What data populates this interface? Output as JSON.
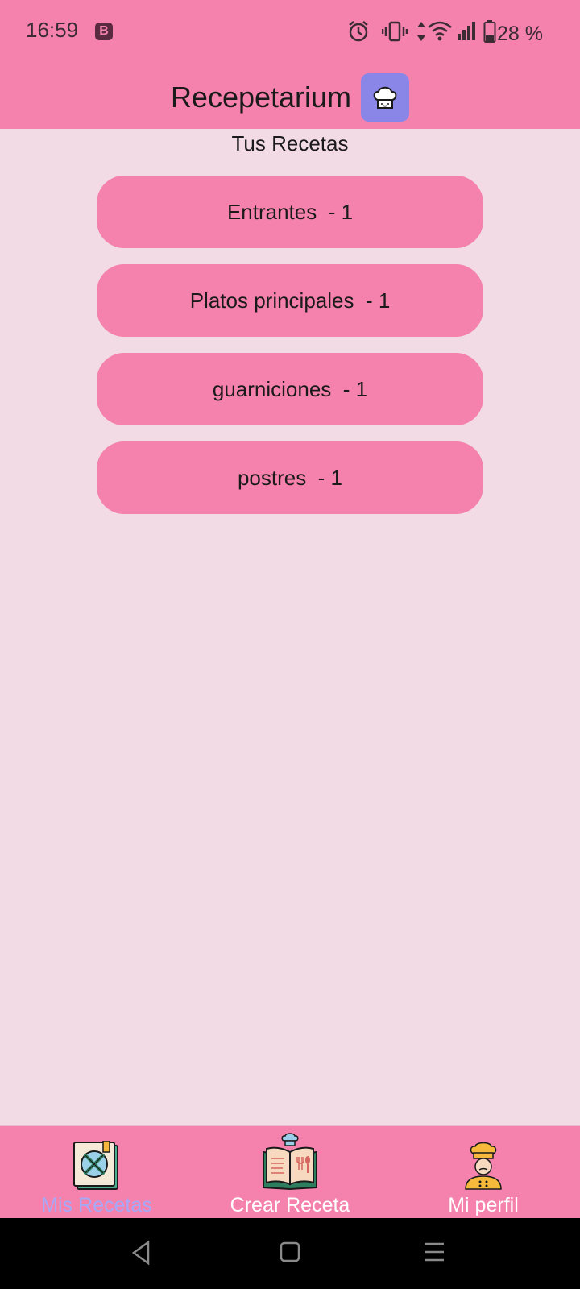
{
  "status_bar": {
    "time": "16:59",
    "notification_badge": "B",
    "battery_text": "28 %",
    "icons": [
      "alarm-icon",
      "vibrate-icon",
      "data-arrows-icon",
      "wifi-icon",
      "signal-icon",
      "battery-icon"
    ]
  },
  "app_bar": {
    "title": "Recepetarium",
    "icon": "chef-hat-icon",
    "icon_bg_color": "#8a86e8"
  },
  "main": {
    "subtitle": "Tus Recetas",
    "categories": [
      {
        "label": "Entrantes  - 1"
      },
      {
        "label": "Platos principales  - 1"
      },
      {
        "label": "guarniciones  - 1"
      },
      {
        "label": "postres  - 1"
      }
    ]
  },
  "bottom_nav": {
    "items": [
      {
        "label": "Mis Recetas",
        "icon": "recipe-book-icon",
        "active": true
      },
      {
        "label": "Crear Receta",
        "icon": "open-cookbook-icon",
        "active": false
      },
      {
        "label": "Mi perfil",
        "icon": "chef-avatar-icon",
        "active": false
      }
    ]
  },
  "colors": {
    "primary": "#f582ac",
    "background": "#f3dbe5",
    "active_nav_label": "#a5a9f7"
  },
  "system_nav": [
    "back-icon",
    "home-icon",
    "recents-icon"
  ]
}
